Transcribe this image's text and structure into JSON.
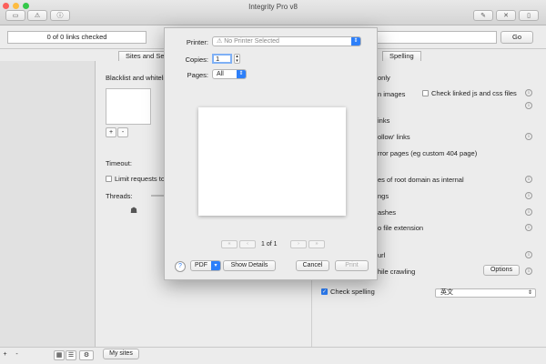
{
  "window": {
    "title": "Integrity Pro v8"
  },
  "toolbar": {
    "left_icons": [
      "printer-icon",
      "warning-icon",
      "info-icon"
    ],
    "right_icons": [
      "tools-icon",
      "settings-icon",
      "sidebar-icon"
    ]
  },
  "urlbar": {
    "links_status": "0 of 0 links checked",
    "go_label": "Go"
  },
  "tabs": [
    {
      "label": "Sites and Se"
    },
    {
      "label": "Spelling"
    }
  ],
  "settings": {
    "blacklist_label": "Blacklist and whiteli",
    "timeout_label": "Timeout:",
    "limit_requests_label": "Limit requests to",
    "threads_label": "Threads:",
    "plus": "+",
    "minus": "-",
    "right_items": [
      "only",
      "n images",
      "Check linked js and css files",
      "inks",
      "ollow' links",
      "rror pages (eg custom 404 page)",
      "es of root domain as internal",
      "ngs",
      "ashes",
      "o file extension",
      "url",
      "hile crawling"
    ],
    "options_label": "Options",
    "check_spelling_label": "Check spelling",
    "language": "英文"
  },
  "bottom": {
    "my_sites_label": "My sites",
    "plus": "+",
    "minus": "-"
  },
  "print_dialog": {
    "printer_label": "Printer:",
    "printer_value": "No Printer Selected",
    "copies_label": "Copies:",
    "copies_value": "1",
    "pages_label": "Pages:",
    "pages_value": "All",
    "page_indicator": "1 of 1",
    "pdf_label": "PDF",
    "show_details_label": "Show Details",
    "cancel_label": "Cancel",
    "print_label": "Print",
    "help_label": "?"
  },
  "colors": {
    "accent": "#2d7ff9",
    "window_bg": "#ececec",
    "sidebar_bg": "#e1e1e1"
  }
}
